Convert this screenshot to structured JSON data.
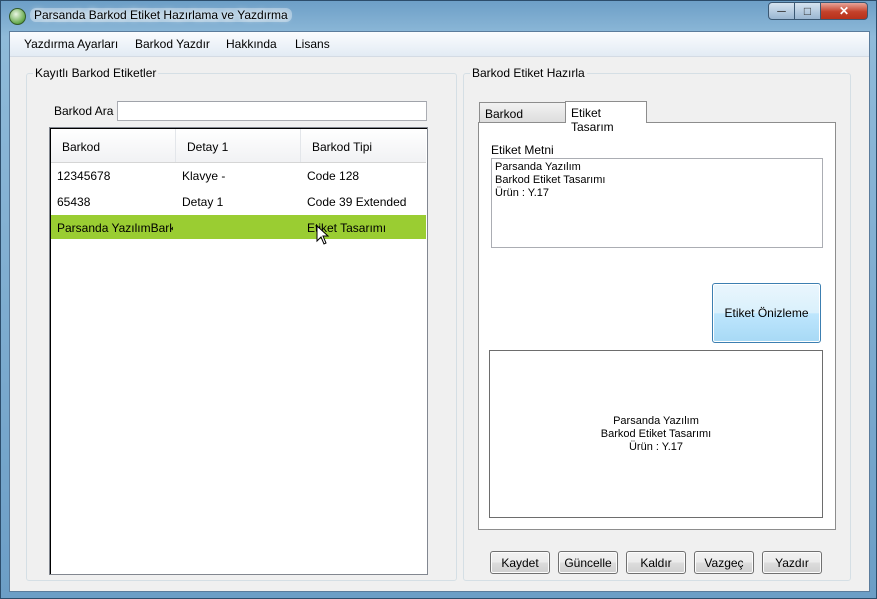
{
  "window": {
    "title": "Parsanda Barkod Etiket Hazırlama ve Yazdırma",
    "minimize_icon": "─",
    "maximize_icon": "□",
    "close_icon": "✕"
  },
  "menu": [
    "Yazdırma Ayarları",
    "Barkod Yazdır",
    "Hakkında",
    "Lisans"
  ],
  "left_panel": {
    "group_title": "Kayıtlı Barkod Etiketler",
    "search_label": "Barkod Ara",
    "search_value": "",
    "columns": [
      "Barkod",
      "Detay 1",
      "Barkod Tipi"
    ],
    "rows": [
      {
        "barkod": "12345678",
        "detay": "Klavye -",
        "tip": "Code 128",
        "selected": false
      },
      {
        "barkod": "65438",
        "detay": "Detay 1",
        "tip": "Code 39 Extended",
        "selected": false
      },
      {
        "barkod": "Parsanda YazılımBark...",
        "detay": "",
        "tip": "Etiket Tasarımı",
        "selected": true
      }
    ],
    "selected_color": "#9acd32"
  },
  "right_panel": {
    "group_title": "Barkod Etiket Hazırla",
    "tabs": [
      "Barkod Tasarım",
      "Etiket Tasarım"
    ],
    "active_tab": 1,
    "label_text_title": "Etiket Metni",
    "label_text_value": "Parsanda Yazılım\nBarkod Etiket Tasarımı\nÜrün : Y.17",
    "preview_button": "Etiket Önizleme",
    "preview_text": "Parsanda Yazılım\nBarkod Etiket Tasarımı\nÜrün : Y.17"
  },
  "buttons": [
    "Kaydet",
    "Güncelle",
    "Kaldır",
    "Vazgeç",
    "Yazdır"
  ]
}
